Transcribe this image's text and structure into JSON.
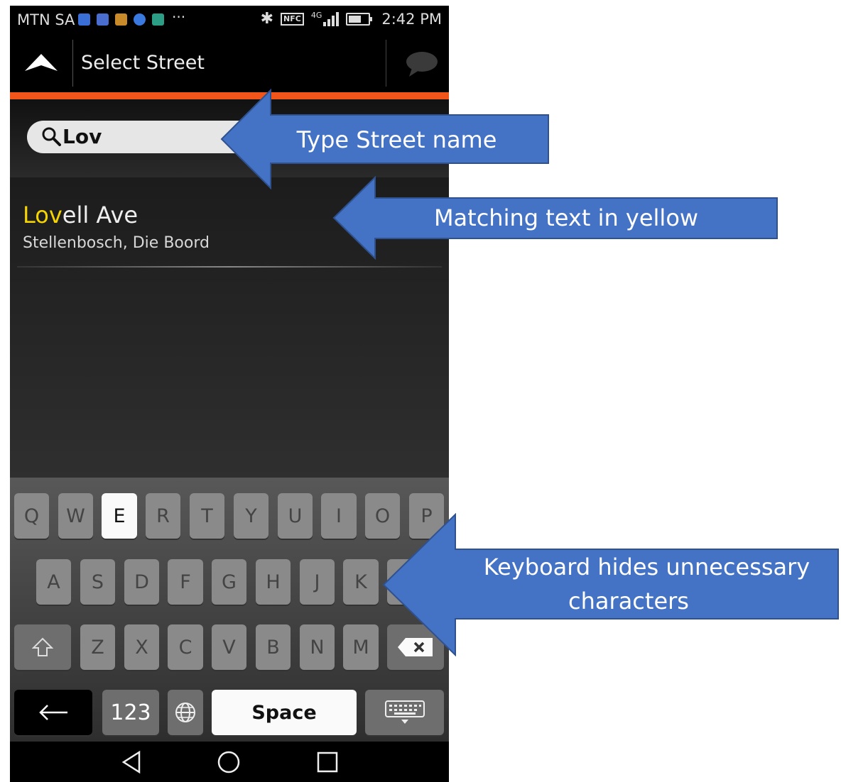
{
  "status_bar": {
    "carrier": "MTN SA",
    "more": "···",
    "nfc": "NFC",
    "network": "4G",
    "time": "2:42 PM"
  },
  "header": {
    "title": "Select Street"
  },
  "search": {
    "value": "Lov"
  },
  "results": [
    {
      "match": "Lov",
      "rest": "ell Ave",
      "subtitle": "Stellenbosch, Die Boord"
    }
  ],
  "keyboard": {
    "row1": [
      "Q",
      "W",
      "E",
      "R",
      "T",
      "Y",
      "U",
      "I",
      "O",
      "P"
    ],
    "row2": [
      "A",
      "S",
      "D",
      "F",
      "G",
      "H",
      "J",
      "K"
    ],
    "row3": [
      "Z",
      "X",
      "C",
      "V",
      "B",
      "N",
      "M"
    ],
    "highlighted_key": "E",
    "numbers_label": "123",
    "space_label": "Space"
  },
  "annotations": {
    "search_hint": "Type Street name",
    "match_hint": "Matching text in yellow",
    "keyboard_hint_line1": "Keyboard hides unnecessary",
    "keyboard_hint_line2": "characters"
  },
  "colors": {
    "accent": "#f2551a",
    "match_highlight": "#f5d400",
    "callout_fill": "#4472c4"
  }
}
